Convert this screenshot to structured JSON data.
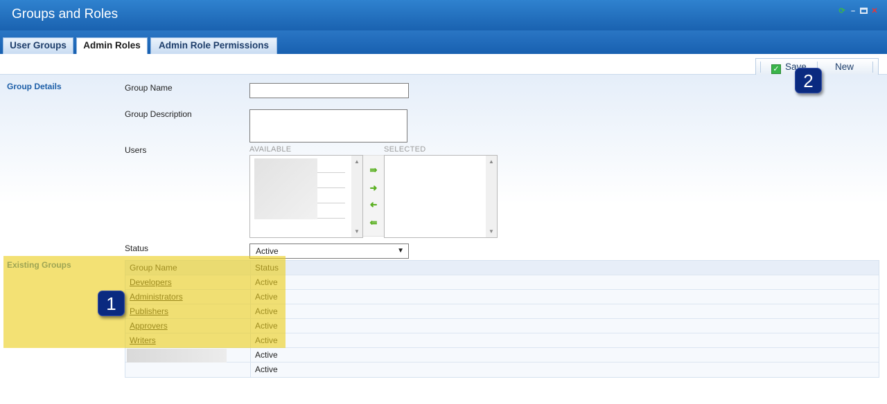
{
  "window": {
    "title": "Groups and Roles"
  },
  "tabs": [
    {
      "label": "User Groups",
      "active": false
    },
    {
      "label": "Admin Roles",
      "active": true
    },
    {
      "label": "Admin Role Permissions",
      "active": false
    }
  ],
  "toolbar": {
    "save_label": "Save",
    "new_label": "New"
  },
  "group_details": {
    "section_label": "Group Details",
    "group_name_label": "Group Name",
    "group_name_value": "",
    "group_description_label": "Group Description",
    "group_description_value": "",
    "users_label": "Users",
    "available_caption": "AVAILABLE",
    "selected_caption": "SELECTED",
    "status_label": "Status",
    "status_value": "Active"
  },
  "existing_groups": {
    "section_label": "Existing Groups",
    "columns": [
      "Group Name",
      "Status"
    ],
    "rows": [
      {
        "name": "Developers",
        "status": "Active"
      },
      {
        "name": "Administrators",
        "status": "Active"
      },
      {
        "name": "Publishers",
        "status": "Active"
      },
      {
        "name": "Approvers",
        "status": "Active"
      },
      {
        "name": "Writers",
        "status": "Active"
      },
      {
        "name": "",
        "status": "Active"
      },
      {
        "name": "",
        "status": "Active"
      }
    ]
  },
  "callouts": [
    "1",
    "2"
  ],
  "colors": {
    "header_blue": "#1a62b0",
    "highlight_yellow": "#ebce1e",
    "callout_navy": "#0a2a80",
    "section_label_blue": "#1d5fa8"
  },
  "icons": [
    "refresh-icon",
    "minimize-icon",
    "restore-icon",
    "close-icon",
    "check-icon",
    "arrow-right-icon",
    "arrow-left-icon"
  ]
}
